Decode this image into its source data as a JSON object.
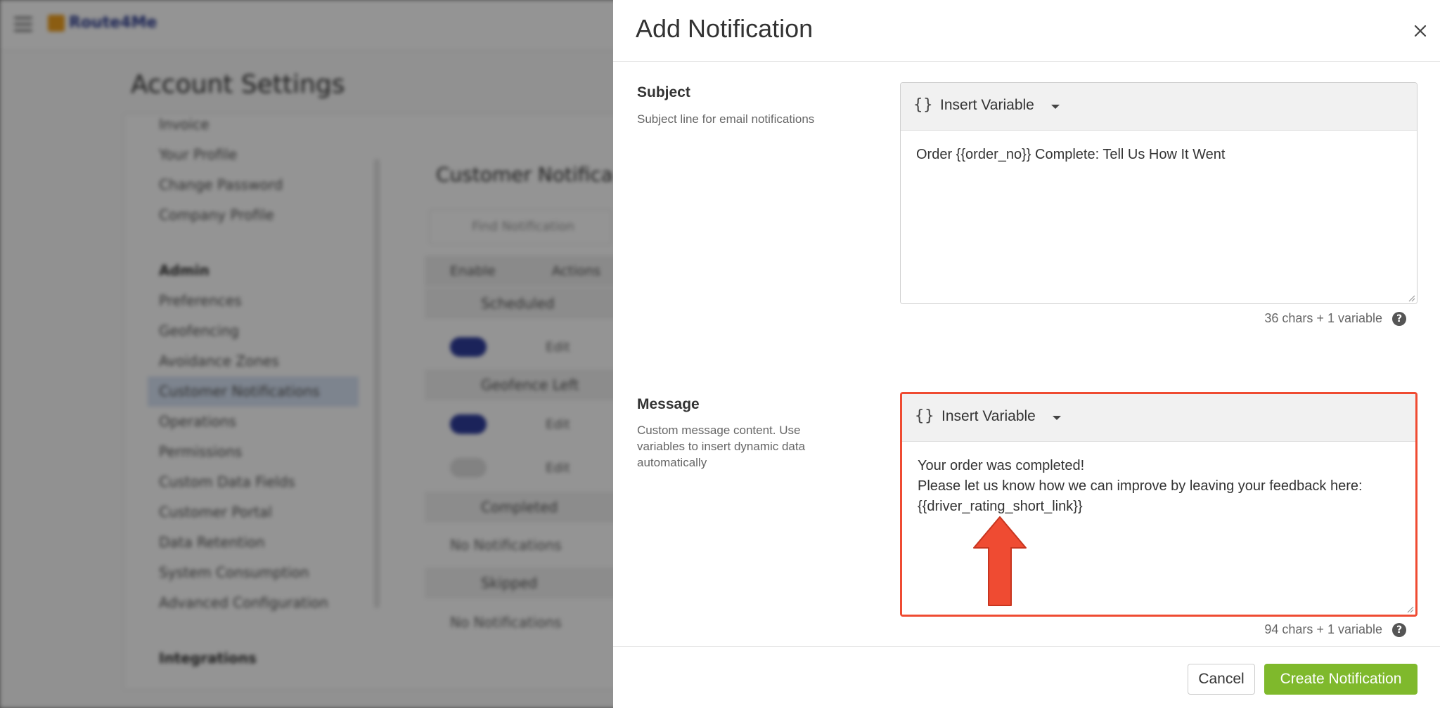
{
  "background": {
    "app_logo": "Route4Me",
    "page_title": "Account Settings",
    "nav": [
      {
        "label": "Invoice",
        "type": "item"
      },
      {
        "label": "Your Profile",
        "type": "item"
      },
      {
        "label": "Change Password",
        "type": "item"
      },
      {
        "label": "Company Profile",
        "type": "item"
      },
      {
        "label": "Admin",
        "type": "head"
      },
      {
        "label": "Preferences",
        "type": "item"
      },
      {
        "label": "Geofencing",
        "type": "item"
      },
      {
        "label": "Avoidance Zones",
        "type": "item"
      },
      {
        "label": "Customer Notifications",
        "type": "active"
      },
      {
        "label": "Operations",
        "type": "item"
      },
      {
        "label": "Permissions",
        "type": "item"
      },
      {
        "label": "Custom Data Fields",
        "type": "item"
      },
      {
        "label": "Customer Portal",
        "type": "item"
      },
      {
        "label": "Data Retention",
        "type": "item"
      },
      {
        "label": "System Consumption",
        "type": "item"
      },
      {
        "label": "Advanced Configuration",
        "type": "item"
      },
      {
        "label": "Integrations",
        "type": "head"
      }
    ],
    "section_title": "Customer Notifica",
    "search_placeholder": "Find Notification",
    "table_columns": [
      "Enable",
      "Actions"
    ],
    "groups": [
      "Scheduled",
      "Geofence Left",
      "Completed",
      "Skipped"
    ],
    "edit_label": "Edit",
    "no_notifications": "No Notifications"
  },
  "drawer": {
    "title": "Add Notification",
    "subject": {
      "label": "Subject",
      "help": "Subject line for email notifications",
      "insert_variable": "Insert Variable",
      "braces": "{}",
      "value": "Order {{order_no}} Complete: Tell Us How It Went",
      "counter": "36 chars + 1 variable"
    },
    "message": {
      "label": "Message",
      "help": "Custom message content. Use variables to insert dynamic data automatically",
      "insert_variable": "Insert Variable",
      "braces": "{}",
      "value": "Your order was completed!\nPlease let us know how we can improve by leaving your feedback here:\n{{driver_rating_short_link}}",
      "counter": "94 chars + 1 variable"
    },
    "help_glyph": "?",
    "cancel_label": "Cancel",
    "create_label": "Create Notification"
  },
  "colors": {
    "primary_green": "#7fb92c",
    "highlight_red": "#ef4b32",
    "toggle_blue": "#2f3d9c"
  }
}
